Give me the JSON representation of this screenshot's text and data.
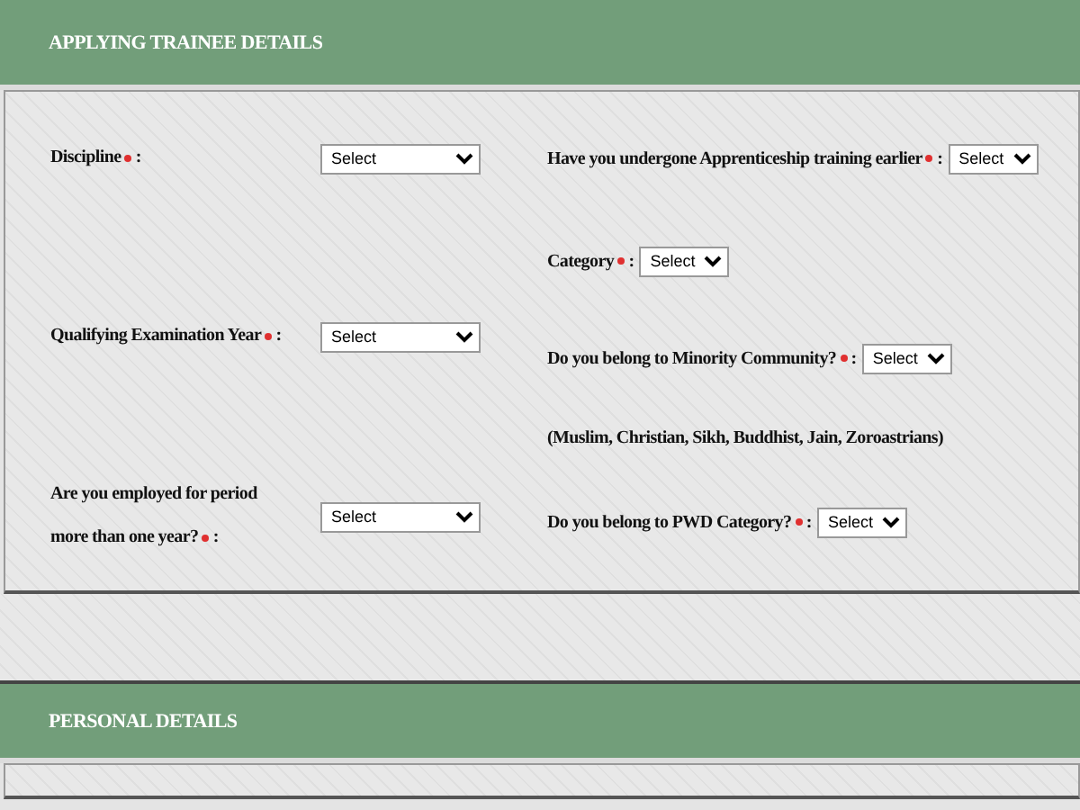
{
  "sections": [
    {
      "title": "APPLYING TRAINEE DETAILS",
      "separator": ":",
      "left_fields": [
        {
          "kind": "select",
          "label": "Discipline",
          "required": true,
          "value": "Select"
        },
        {
          "kind": "select",
          "label": "Qualifying Examination Year",
          "required": true,
          "value": "Select"
        },
        {
          "kind": "select",
          "label": "Are you employed for period more than one year?",
          "required": true,
          "value": "Select"
        }
      ],
      "right_fields": [
        {
          "kind": "select",
          "label": "Have you undergone Apprenticeship training earlier",
          "required": true,
          "value": "Select"
        },
        {
          "kind": "select",
          "label": "Category",
          "required": true,
          "value": "Select"
        },
        {
          "kind": "select",
          "label": "Do you belong to Minority Community?",
          "required": true,
          "value": "Select"
        },
        {
          "kind": "note",
          "label": "(Muslim, Christian, Sikh, Buddhist, Jain, Zoroastrians)"
        },
        {
          "kind": "select",
          "label": "Do you belong to PWD Category?",
          "required": true,
          "value": "Select"
        }
      ]
    },
    {
      "title": "PERSONAL DETAILS"
    }
  ]
}
